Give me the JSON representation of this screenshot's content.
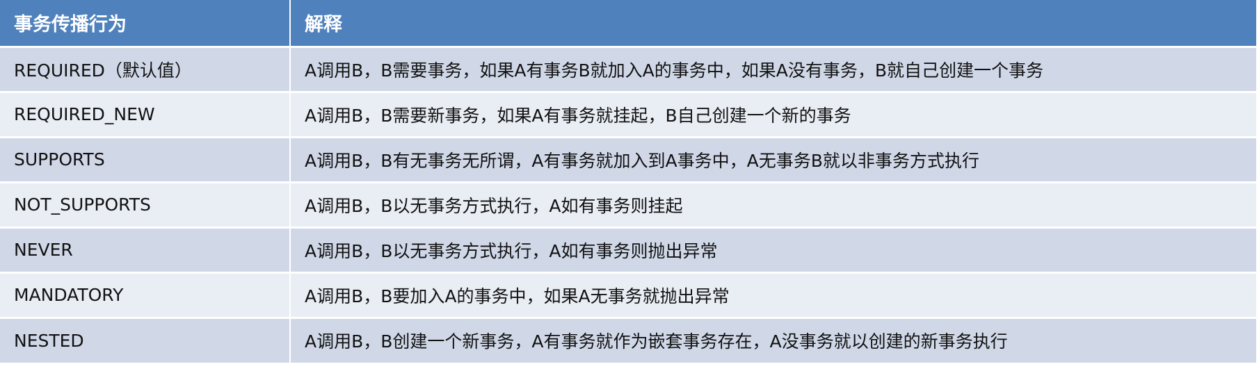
{
  "table": {
    "headers": [
      "事务传播行为",
      "解释"
    ],
    "rows": [
      {
        "behavior": "REQUIRED（默认值）",
        "explanation": "A调用B，B需要事务，如果A有事务B就加入A的事务中，如果A没有事务，B就自己创建一个事务"
      },
      {
        "behavior": "REQUIRED_NEW",
        "explanation": "A调用B，B需要新事务，如果A有事务就挂起，B自己创建一个新的事务"
      },
      {
        "behavior": "SUPPORTS",
        "explanation": "A调用B，B有无事务无所谓，A有事务就加入到A事务中，A无事务B就以非事务方式执行"
      },
      {
        "behavior": "NOT_SUPPORTS",
        "explanation": "A调用B，B以无事务方式执行，A如有事务则挂起"
      },
      {
        "behavior": "NEVER",
        "explanation": "A调用B，B以无事务方式执行，A如有事务则抛出异常"
      },
      {
        "behavior": "MANDATORY",
        "explanation": "A调用B，B要加入A的事务中，如果A无事务就抛出异常"
      },
      {
        "behavior": "NESTED",
        "explanation": "A调用B，B创建一个新事务，A有事务就作为嵌套事务存在，A没事务就以创建的新事务执行"
      }
    ]
  },
  "colors": {
    "header_bg": "#4f81bd",
    "row_odd_bg": "#d0d8e8",
    "row_even_bg": "#e9edf4"
  }
}
